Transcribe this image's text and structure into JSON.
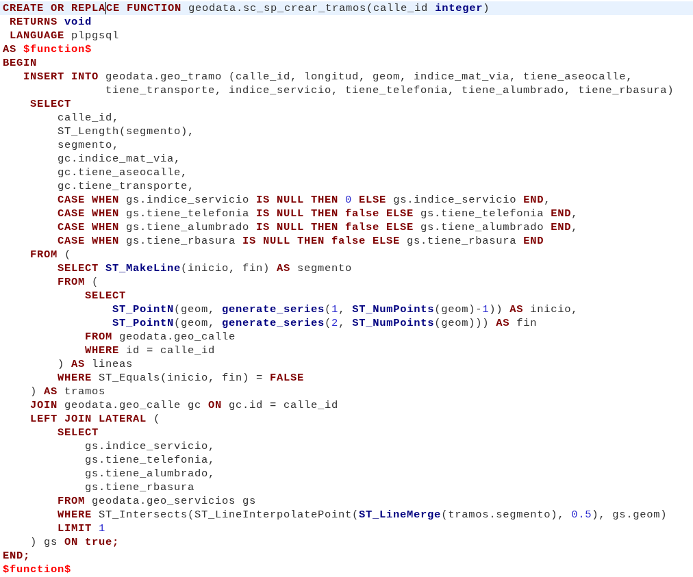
{
  "editor": {
    "lines": [
      {
        "current": true,
        "tokens": [
          {
            "kind": "keyword",
            "text": "CREATE OR REPLA"
          },
          {
            "kind": "keyword",
            "text": "CE FUNCTION",
            "caret": true
          },
          {
            "kind": "plain",
            "text": " geodata.sc_sp_crear_tramos(calle_id "
          },
          {
            "kind": "function",
            "text": "integer"
          },
          {
            "kind": "plain",
            "text": ")"
          }
        ]
      },
      {
        "current": false,
        "tokens": [
          {
            "kind": "keyword",
            "text": " RETURNS "
          },
          {
            "kind": "function",
            "text": "void"
          }
        ]
      },
      {
        "current": false,
        "tokens": [
          {
            "kind": "keyword",
            "text": " LANGUAGE"
          },
          {
            "kind": "plain",
            "text": " plpgsql"
          }
        ]
      },
      {
        "current": false,
        "tokens": [
          {
            "kind": "keyword",
            "text": "AS "
          },
          {
            "kind": "dollar",
            "text": "$function$"
          }
        ]
      },
      {
        "current": false,
        "tokens": [
          {
            "kind": "keyword",
            "text": "BEGIN"
          }
        ]
      },
      {
        "current": false,
        "tokens": [
          {
            "kind": "keyword",
            "text": "   INSERT INTO"
          },
          {
            "kind": "plain",
            "text": " geodata.geo_tramo (calle_id, longitud, geom, indice_mat_via, tiene_aseocalle,"
          }
        ]
      },
      {
        "current": false,
        "tokens": [
          {
            "kind": "plain",
            "text": "               tiene_transporte, indice_servicio, tiene_telefonia, tiene_alumbrado, tiene_rbasura)"
          }
        ]
      },
      {
        "current": false,
        "tokens": [
          {
            "kind": "keyword",
            "text": "    SELECT"
          }
        ]
      },
      {
        "current": false,
        "tokens": [
          {
            "kind": "plain",
            "text": "        calle_id,"
          }
        ]
      },
      {
        "current": false,
        "tokens": [
          {
            "kind": "plain",
            "text": "        ST_Length(segmento),"
          }
        ]
      },
      {
        "current": false,
        "tokens": [
          {
            "kind": "plain",
            "text": "        segmento,"
          }
        ]
      },
      {
        "current": false,
        "tokens": [
          {
            "kind": "plain",
            "text": "        gc.indice_mat_via,"
          }
        ]
      },
      {
        "current": false,
        "tokens": [
          {
            "kind": "plain",
            "text": "        gc.tiene_aseocalle,"
          }
        ]
      },
      {
        "current": false,
        "tokens": [
          {
            "kind": "plain",
            "text": "        gc.tiene_transporte,"
          }
        ]
      },
      {
        "current": false,
        "tokens": [
          {
            "kind": "keyword",
            "text": "        CASE WHEN"
          },
          {
            "kind": "plain",
            "text": " gs.indice_servicio "
          },
          {
            "kind": "keyword",
            "text": "IS NULL THEN "
          },
          {
            "kind": "number",
            "text": "0"
          },
          {
            "kind": "keyword",
            "text": " ELSE"
          },
          {
            "kind": "plain",
            "text": " gs.indice_servicio "
          },
          {
            "kind": "keyword",
            "text": "END"
          },
          {
            "kind": "plain",
            "text": ","
          }
        ]
      },
      {
        "current": false,
        "tokens": [
          {
            "kind": "keyword",
            "text": "        CASE WHEN"
          },
          {
            "kind": "plain",
            "text": " gs.tiene_telefonia "
          },
          {
            "kind": "keyword",
            "text": "IS NULL THEN false ELSE"
          },
          {
            "kind": "plain",
            "text": " gs.tiene_telefonia "
          },
          {
            "kind": "keyword",
            "text": "END"
          },
          {
            "kind": "plain",
            "text": ","
          }
        ]
      },
      {
        "current": false,
        "tokens": [
          {
            "kind": "keyword",
            "text": "        CASE WHEN"
          },
          {
            "kind": "plain",
            "text": " gs.tiene_alumbrado "
          },
          {
            "kind": "keyword",
            "text": "IS NULL THEN false ELSE"
          },
          {
            "kind": "plain",
            "text": " gs.tiene_alumbrado "
          },
          {
            "kind": "keyword",
            "text": "END"
          },
          {
            "kind": "plain",
            "text": ","
          }
        ]
      },
      {
        "current": false,
        "tokens": [
          {
            "kind": "keyword",
            "text": "        CASE WHEN"
          },
          {
            "kind": "plain",
            "text": " gs.tiene_rbasura "
          },
          {
            "kind": "keyword",
            "text": "IS NULL THEN false ELSE"
          },
          {
            "kind": "plain",
            "text": " gs.tiene_rbasura "
          },
          {
            "kind": "keyword",
            "text": "END"
          }
        ]
      },
      {
        "current": false,
        "tokens": [
          {
            "kind": "keyword",
            "text": "    FROM"
          },
          {
            "kind": "plain",
            "text": " ("
          }
        ]
      },
      {
        "current": false,
        "tokens": [
          {
            "kind": "keyword",
            "text": "        SELECT "
          },
          {
            "kind": "function",
            "text": "ST_MakeLine"
          },
          {
            "kind": "plain",
            "text": "(inicio, fin) "
          },
          {
            "kind": "keyword",
            "text": "AS"
          },
          {
            "kind": "plain",
            "text": " segmento"
          }
        ]
      },
      {
        "current": false,
        "tokens": [
          {
            "kind": "keyword",
            "text": "        FROM"
          },
          {
            "kind": "plain",
            "text": " ("
          }
        ]
      },
      {
        "current": false,
        "tokens": [
          {
            "kind": "keyword",
            "text": "            SELECT"
          }
        ]
      },
      {
        "current": false,
        "tokens": [
          {
            "kind": "function",
            "text": "                ST_PointN"
          },
          {
            "kind": "plain",
            "text": "(geom, "
          },
          {
            "kind": "function",
            "text": "generate_series"
          },
          {
            "kind": "plain",
            "text": "("
          },
          {
            "kind": "number",
            "text": "1"
          },
          {
            "kind": "plain",
            "text": ", "
          },
          {
            "kind": "function",
            "text": "ST_NumPoints"
          },
          {
            "kind": "plain",
            "text": "(geom)-"
          },
          {
            "kind": "number",
            "text": "1"
          },
          {
            "kind": "plain",
            "text": ")) "
          },
          {
            "kind": "keyword",
            "text": "AS"
          },
          {
            "kind": "plain",
            "text": " inicio,"
          }
        ]
      },
      {
        "current": false,
        "tokens": [
          {
            "kind": "function",
            "text": "                ST_PointN"
          },
          {
            "kind": "plain",
            "text": "(geom, "
          },
          {
            "kind": "function",
            "text": "generate_series"
          },
          {
            "kind": "plain",
            "text": "("
          },
          {
            "kind": "number",
            "text": "2"
          },
          {
            "kind": "plain",
            "text": ", "
          },
          {
            "kind": "function",
            "text": "ST_NumPoints"
          },
          {
            "kind": "plain",
            "text": "(geom))) "
          },
          {
            "kind": "keyword",
            "text": "AS"
          },
          {
            "kind": "plain",
            "text": " fin"
          }
        ]
      },
      {
        "current": false,
        "tokens": [
          {
            "kind": "keyword",
            "text": "            FROM"
          },
          {
            "kind": "plain",
            "text": " geodata.geo_calle"
          }
        ]
      },
      {
        "current": false,
        "tokens": [
          {
            "kind": "keyword",
            "text": "            WHERE"
          },
          {
            "kind": "plain",
            "text": " id = calle_id"
          }
        ]
      },
      {
        "current": false,
        "tokens": [
          {
            "kind": "plain",
            "text": "        ) "
          },
          {
            "kind": "keyword",
            "text": "AS"
          },
          {
            "kind": "plain",
            "text": " lineas"
          }
        ]
      },
      {
        "current": false,
        "tokens": [
          {
            "kind": "keyword",
            "text": "        WHERE"
          },
          {
            "kind": "plain",
            "text": " ST_Equals(inicio, fin) = "
          },
          {
            "kind": "keyword",
            "text": "FALSE"
          }
        ]
      },
      {
        "current": false,
        "tokens": [
          {
            "kind": "plain",
            "text": "    ) "
          },
          {
            "kind": "keyword",
            "text": "AS"
          },
          {
            "kind": "plain",
            "text": " tramos"
          }
        ]
      },
      {
        "current": false,
        "tokens": [
          {
            "kind": "keyword",
            "text": "    JOIN"
          },
          {
            "kind": "plain",
            "text": " geodata.geo_calle gc "
          },
          {
            "kind": "keyword",
            "text": "ON"
          },
          {
            "kind": "plain",
            "text": " gc.id = calle_id"
          }
        ]
      },
      {
        "current": false,
        "tokens": [
          {
            "kind": "keyword",
            "text": "    LEFT JOIN LATERAL"
          },
          {
            "kind": "plain",
            "text": " ("
          }
        ]
      },
      {
        "current": false,
        "tokens": [
          {
            "kind": "keyword",
            "text": "        SELECT"
          }
        ]
      },
      {
        "current": false,
        "tokens": [
          {
            "kind": "plain",
            "text": "            gs.indice_servicio,"
          }
        ]
      },
      {
        "current": false,
        "tokens": [
          {
            "kind": "plain",
            "text": "            gs.tiene_telefonia,"
          }
        ]
      },
      {
        "current": false,
        "tokens": [
          {
            "kind": "plain",
            "text": "            gs.tiene_alumbrado,"
          }
        ]
      },
      {
        "current": false,
        "tokens": [
          {
            "kind": "plain",
            "text": "            gs.tiene_rbasura"
          }
        ]
      },
      {
        "current": false,
        "tokens": [
          {
            "kind": "keyword",
            "text": "        FROM"
          },
          {
            "kind": "plain",
            "text": " geodata.geo_servicios gs"
          }
        ]
      },
      {
        "current": false,
        "tokens": [
          {
            "kind": "keyword",
            "text": "        WHERE"
          },
          {
            "kind": "plain",
            "text": " ST_Intersects(ST_LineInterpolatePoint("
          },
          {
            "kind": "function",
            "text": "ST_LineMerge"
          },
          {
            "kind": "plain",
            "text": "(tramos.segmento), "
          },
          {
            "kind": "number",
            "text": "0.5"
          },
          {
            "kind": "plain",
            "text": "), gs.geom)"
          }
        ]
      },
      {
        "current": false,
        "tokens": [
          {
            "kind": "keyword",
            "text": "        LIMIT "
          },
          {
            "kind": "number",
            "text": "1"
          }
        ]
      },
      {
        "current": false,
        "tokens": [
          {
            "kind": "plain",
            "text": "    ) gs "
          },
          {
            "kind": "keyword",
            "text": "ON true;"
          }
        ]
      },
      {
        "current": false,
        "tokens": [
          {
            "kind": "keyword",
            "text": "END;"
          }
        ]
      },
      {
        "current": false,
        "tokens": [
          {
            "kind": "dollar",
            "text": "$function$"
          }
        ]
      }
    ]
  }
}
